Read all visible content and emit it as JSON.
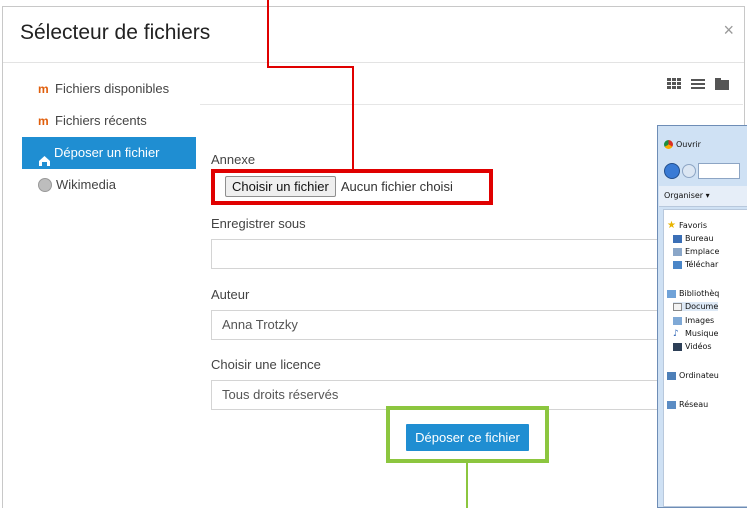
{
  "dialog": {
    "title": "Sélecteur de fichiers",
    "close_label": "×"
  },
  "sidebar": {
    "items": [
      {
        "label": "Fichiers disponibles",
        "icon": "moodle-icon",
        "active": false
      },
      {
        "label": "Fichiers récents",
        "icon": "moodle-icon",
        "active": false
      },
      {
        "label": "Déposer un fichier",
        "icon": "upload-icon",
        "active": true
      },
      {
        "label": "Wikimedia",
        "icon": "globe-icon",
        "active": false
      }
    ]
  },
  "form": {
    "attachment_label": "Annexe",
    "choose_button": "Choisir un fichier",
    "no_file": "Aucun fichier choisi",
    "save_as_label": "Enregistrer sous",
    "save_as_value": "",
    "author_label": "Auteur",
    "author_value": "Anna Trotzky",
    "license_label": "Choisir une licence",
    "license_value": "Tous droits réservés",
    "submit_button": "Déposer ce fichier"
  },
  "colors": {
    "accent": "#1f8ed2",
    "highlight_red": "#e00000",
    "highlight_green": "#8cc63f"
  },
  "os_dialog": {
    "title": "Ouvrir",
    "organize": "Organiser ▾",
    "items": [
      {
        "label": "Favoris",
        "icon": "star-icon"
      },
      {
        "label": "Bureau",
        "icon": "desktop-icon"
      },
      {
        "label": "Emplace",
        "icon": "places-icon"
      },
      {
        "label": "Téléchar",
        "icon": "downloads-icon"
      },
      {
        "label": "Bibliothèq",
        "icon": "library-icon"
      },
      {
        "label": "Docume",
        "icon": "document-icon"
      },
      {
        "label": "Images",
        "icon": "images-icon"
      },
      {
        "label": "Musique",
        "icon": "music-icon"
      },
      {
        "label": "Vidéos",
        "icon": "videos-icon"
      },
      {
        "label": "Ordinateu",
        "icon": "computer-icon"
      },
      {
        "label": "Réseau",
        "icon": "network-icon"
      }
    ]
  }
}
